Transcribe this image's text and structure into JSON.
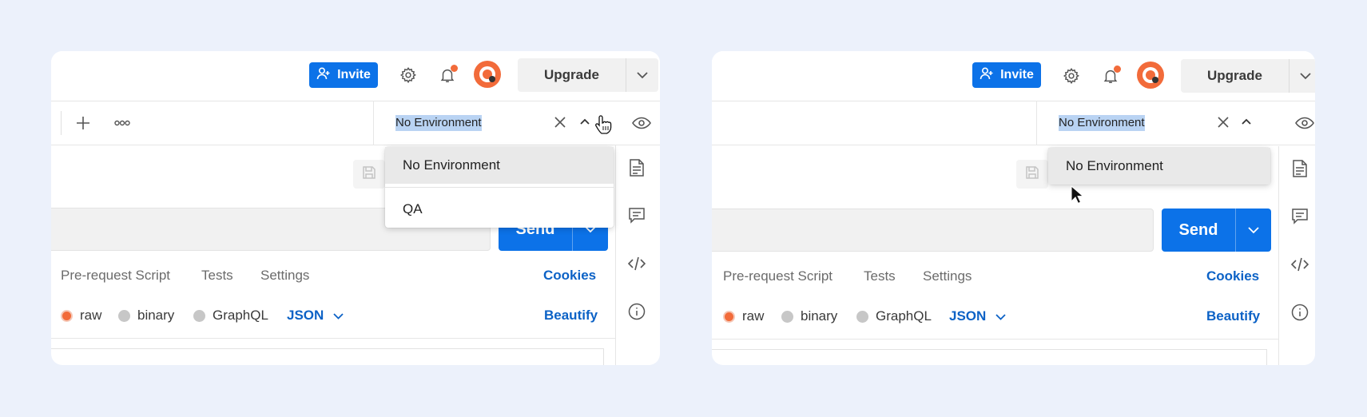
{
  "colors": {
    "accent": "#0c72e8",
    "link": "#0c62c6",
    "notification": "#f26b3a",
    "selection": "#b9d3f3",
    "background": "#ecf1fb"
  },
  "left": {
    "header": {
      "invite_label": "Invite",
      "upgrade_label": "Upgrade"
    },
    "env": {
      "value": "No Environment"
    },
    "dropdown": {
      "items": [
        "No Environment",
        "QA"
      ]
    },
    "send_label": "Send",
    "subtabs": [
      "Pre-request Script",
      "Tests",
      "Settings"
    ],
    "cookies_label": "Cookies",
    "body_types": [
      "raw",
      "binary",
      "GraphQL"
    ],
    "body_format": "JSON",
    "beautify_label": "Beautify"
  },
  "right": {
    "header": {
      "invite_label": "Invite",
      "upgrade_label": "Upgrade"
    },
    "env": {
      "value": "No Environment"
    },
    "dropdown": {
      "items": [
        "No Environment"
      ]
    },
    "send_label": "Send",
    "subtabs": [
      "Pre-request Script",
      "Tests",
      "Settings"
    ],
    "cookies_label": "Cookies",
    "body_types": [
      "raw",
      "binary",
      "GraphQL"
    ],
    "body_format": "JSON",
    "beautify_label": "Beautify"
  }
}
